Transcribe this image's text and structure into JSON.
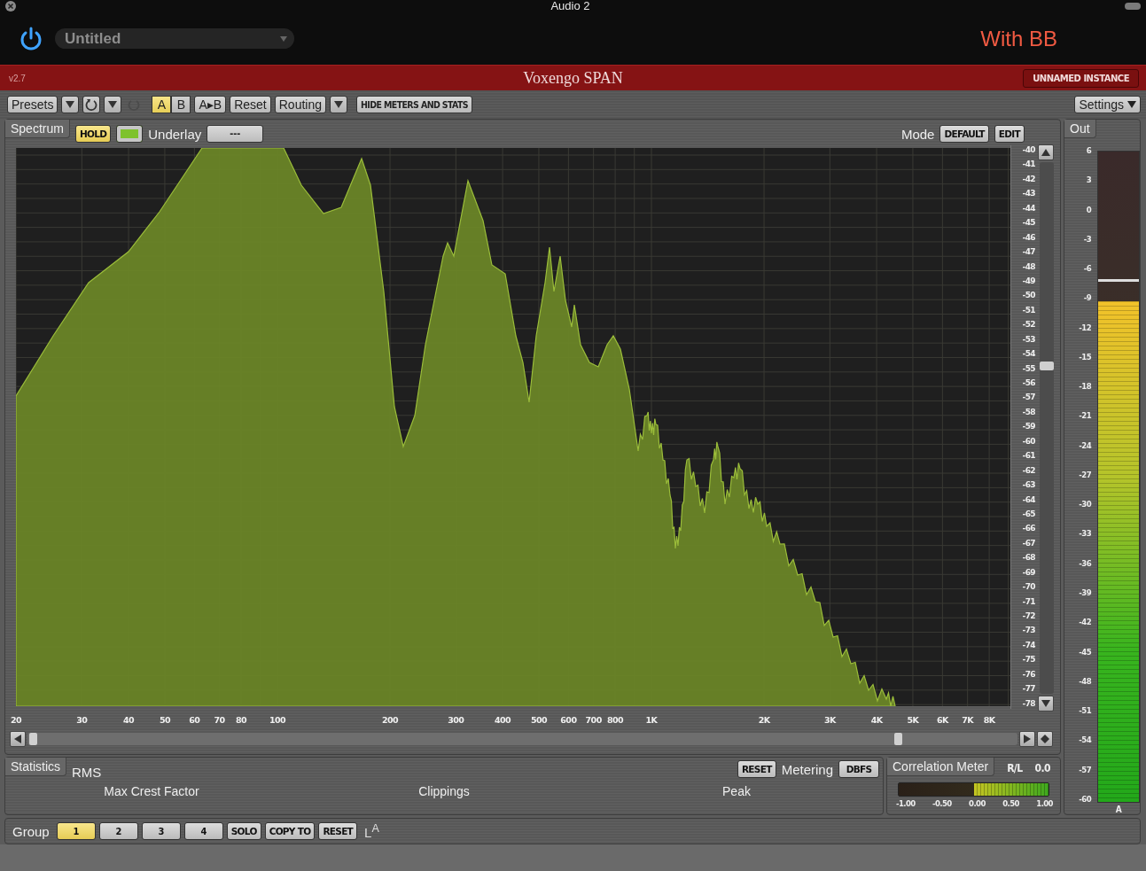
{
  "window": {
    "title": "Audio 2"
  },
  "host": {
    "power_on": true,
    "preset": "Untitled",
    "label": "With BB"
  },
  "plugin_bar": {
    "version": "v2.7",
    "name": "Voxengo SPAN",
    "instance": "UNNAMED INSTANCE"
  },
  "toolbar": {
    "presets": "Presets",
    "redo": {
      "disabled": true
    },
    "ab": [
      {
        "label": "A",
        "selected": true
      },
      {
        "label": "B",
        "selected": false
      }
    ],
    "copy_ab": "A▸B",
    "reset": "Reset",
    "routing": "Routing",
    "hide": "HIDE METERS AND STATS",
    "settings": "Settings"
  },
  "spectrum": {
    "tab": "Spectrum",
    "hold": {
      "label": "HOLD",
      "on": true
    },
    "underlay_label": "Underlay",
    "underlay_value": "---",
    "mode_label": "Mode",
    "mode_buttons": [
      "DEFAULT",
      "EDIT"
    ],
    "y_labels": [
      "-40",
      "-41",
      "-42",
      "-43",
      "-44",
      "-45",
      "-46",
      "-47",
      "-48",
      "-49",
      "-50",
      "-51",
      "-52",
      "-53",
      "-54",
      "-55",
      "-56",
      "-57",
      "-58",
      "-59",
      "-60",
      "-61",
      "-62",
      "-63",
      "-64",
      "-65",
      "-66",
      "-67",
      "-68",
      "-69",
      "-70",
      "-71",
      "-72",
      "-73",
      "-74",
      "-75",
      "-76",
      "-77",
      "-78"
    ],
    "x_labels": [
      "20",
      "30",
      "40",
      "50",
      "60",
      "70",
      "80",
      "100",
      "200",
      "300",
      "400",
      "500",
      "600",
      "700",
      "800",
      "1K",
      "2K",
      "3K",
      "4K",
      "5K",
      "6K",
      "7K",
      "8K"
    ]
  },
  "out_meter": {
    "tab": "Out",
    "scale": [
      "6",
      "3",
      "0",
      "-3",
      "-6",
      "-9",
      "-12",
      "-15",
      "-18",
      "-21",
      "-24",
      "-27",
      "-30",
      "-33",
      "-36",
      "-39",
      "-42",
      "-45",
      "-48",
      "-51",
      "-54",
      "-57",
      "-60"
    ],
    "level": 0.77,
    "channel": "A"
  },
  "statistics": {
    "tab": "Statistics",
    "mode": "RMS",
    "reset": "RESET",
    "metering_label": "Metering",
    "metering_value": "DBFS",
    "columns": [
      "Max Crest Factor",
      "Clippings",
      "Peak"
    ]
  },
  "correlation": {
    "tab": "Correlation Meter",
    "channels": "R/L",
    "value": "0.0",
    "level": 0.5,
    "scale": [
      "-1.00",
      "-0.50",
      "0.00",
      "0.50",
      "1.00"
    ]
  },
  "group": {
    "label": "Group",
    "buttons": [
      {
        "label": "1",
        "selected": true
      },
      {
        "label": "2",
        "selected": false
      },
      {
        "label": "3",
        "selected": false
      },
      {
        "label": "4",
        "selected": false
      }
    ],
    "actions": [
      "SOLO",
      "COPY TO",
      "RESET"
    ],
    "link": "L$^{A}$"
  }
}
